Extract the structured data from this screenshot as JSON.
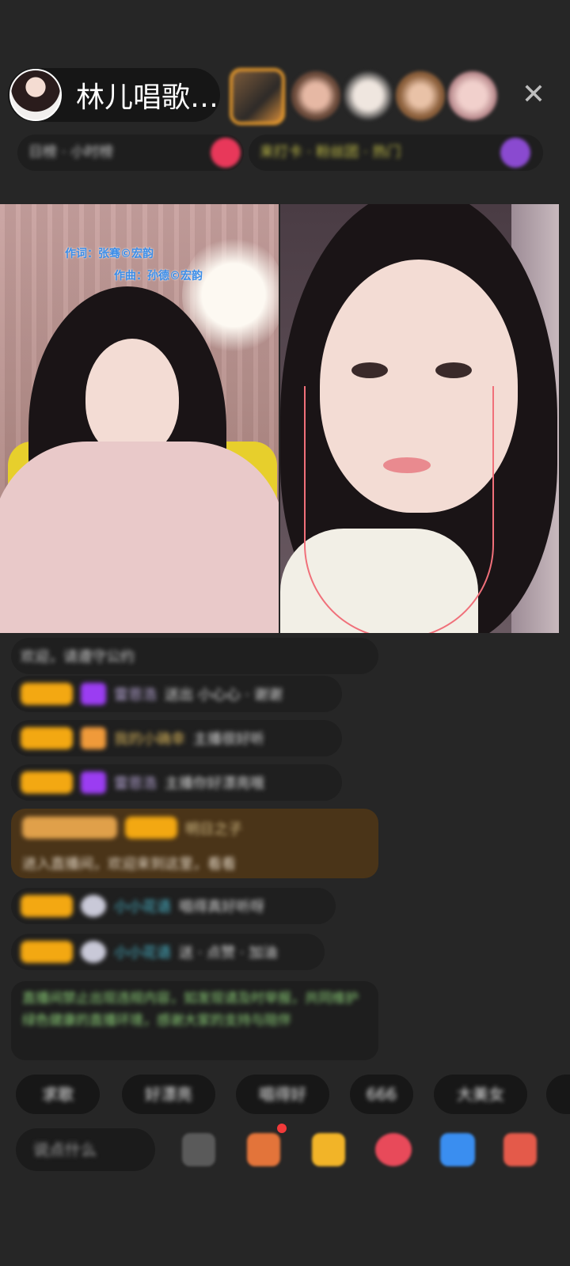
{
  "header": {
    "host_name": "林儿唱歌…",
    "close_symbol": "✕"
  },
  "banner": {
    "left_text": "日榜 · 小时榜",
    "right_text": "来打卡 · 粉丝团 · 热门"
  },
  "video": {
    "lyric_line_1": "作词：张骞©宏韵",
    "lyric_line_2": "作曲：孙德©宏韵"
  },
  "chat": {
    "messages": [
      {
        "text": "欢迎，请遵守公约"
      },
      {
        "badge": "粉丝",
        "user": "雷恩浩",
        "body": "送出 小心心 · 谢谢"
      },
      {
        "badge": "主播",
        "user": "我的小确幸",
        "body": "主播很好听"
      },
      {
        "badge": "粉丝",
        "user": "雷恩浩",
        "body": "主播你好漂亮哦"
      },
      {
        "badge": "主播",
        "user": "明日之子",
        "body": "进入直播间，欢迎来到这里，看看"
      },
      {
        "badge": "粉丝",
        "user": "小小花语",
        "body": "唱得真好听呀"
      },
      {
        "badge": "粉丝",
        "user": "小小花语",
        "body": "送 · 点赞 · 加油"
      },
      {
        "text": "直播间禁止出现违规内容，如发现请及时举报，共同维护绿色健康的直播环境，感谢大家的支持与陪伴"
      }
    ]
  },
  "quick_replies": [
    "求歌",
    "好漂亮",
    "唱得好",
    "666",
    "大美女"
  ],
  "bottom": {
    "comment_placeholder": "说点什么"
  },
  "colors": {
    "background": "#262626",
    "accent": "#f3a812",
    "system_text": "#8fd47a"
  }
}
